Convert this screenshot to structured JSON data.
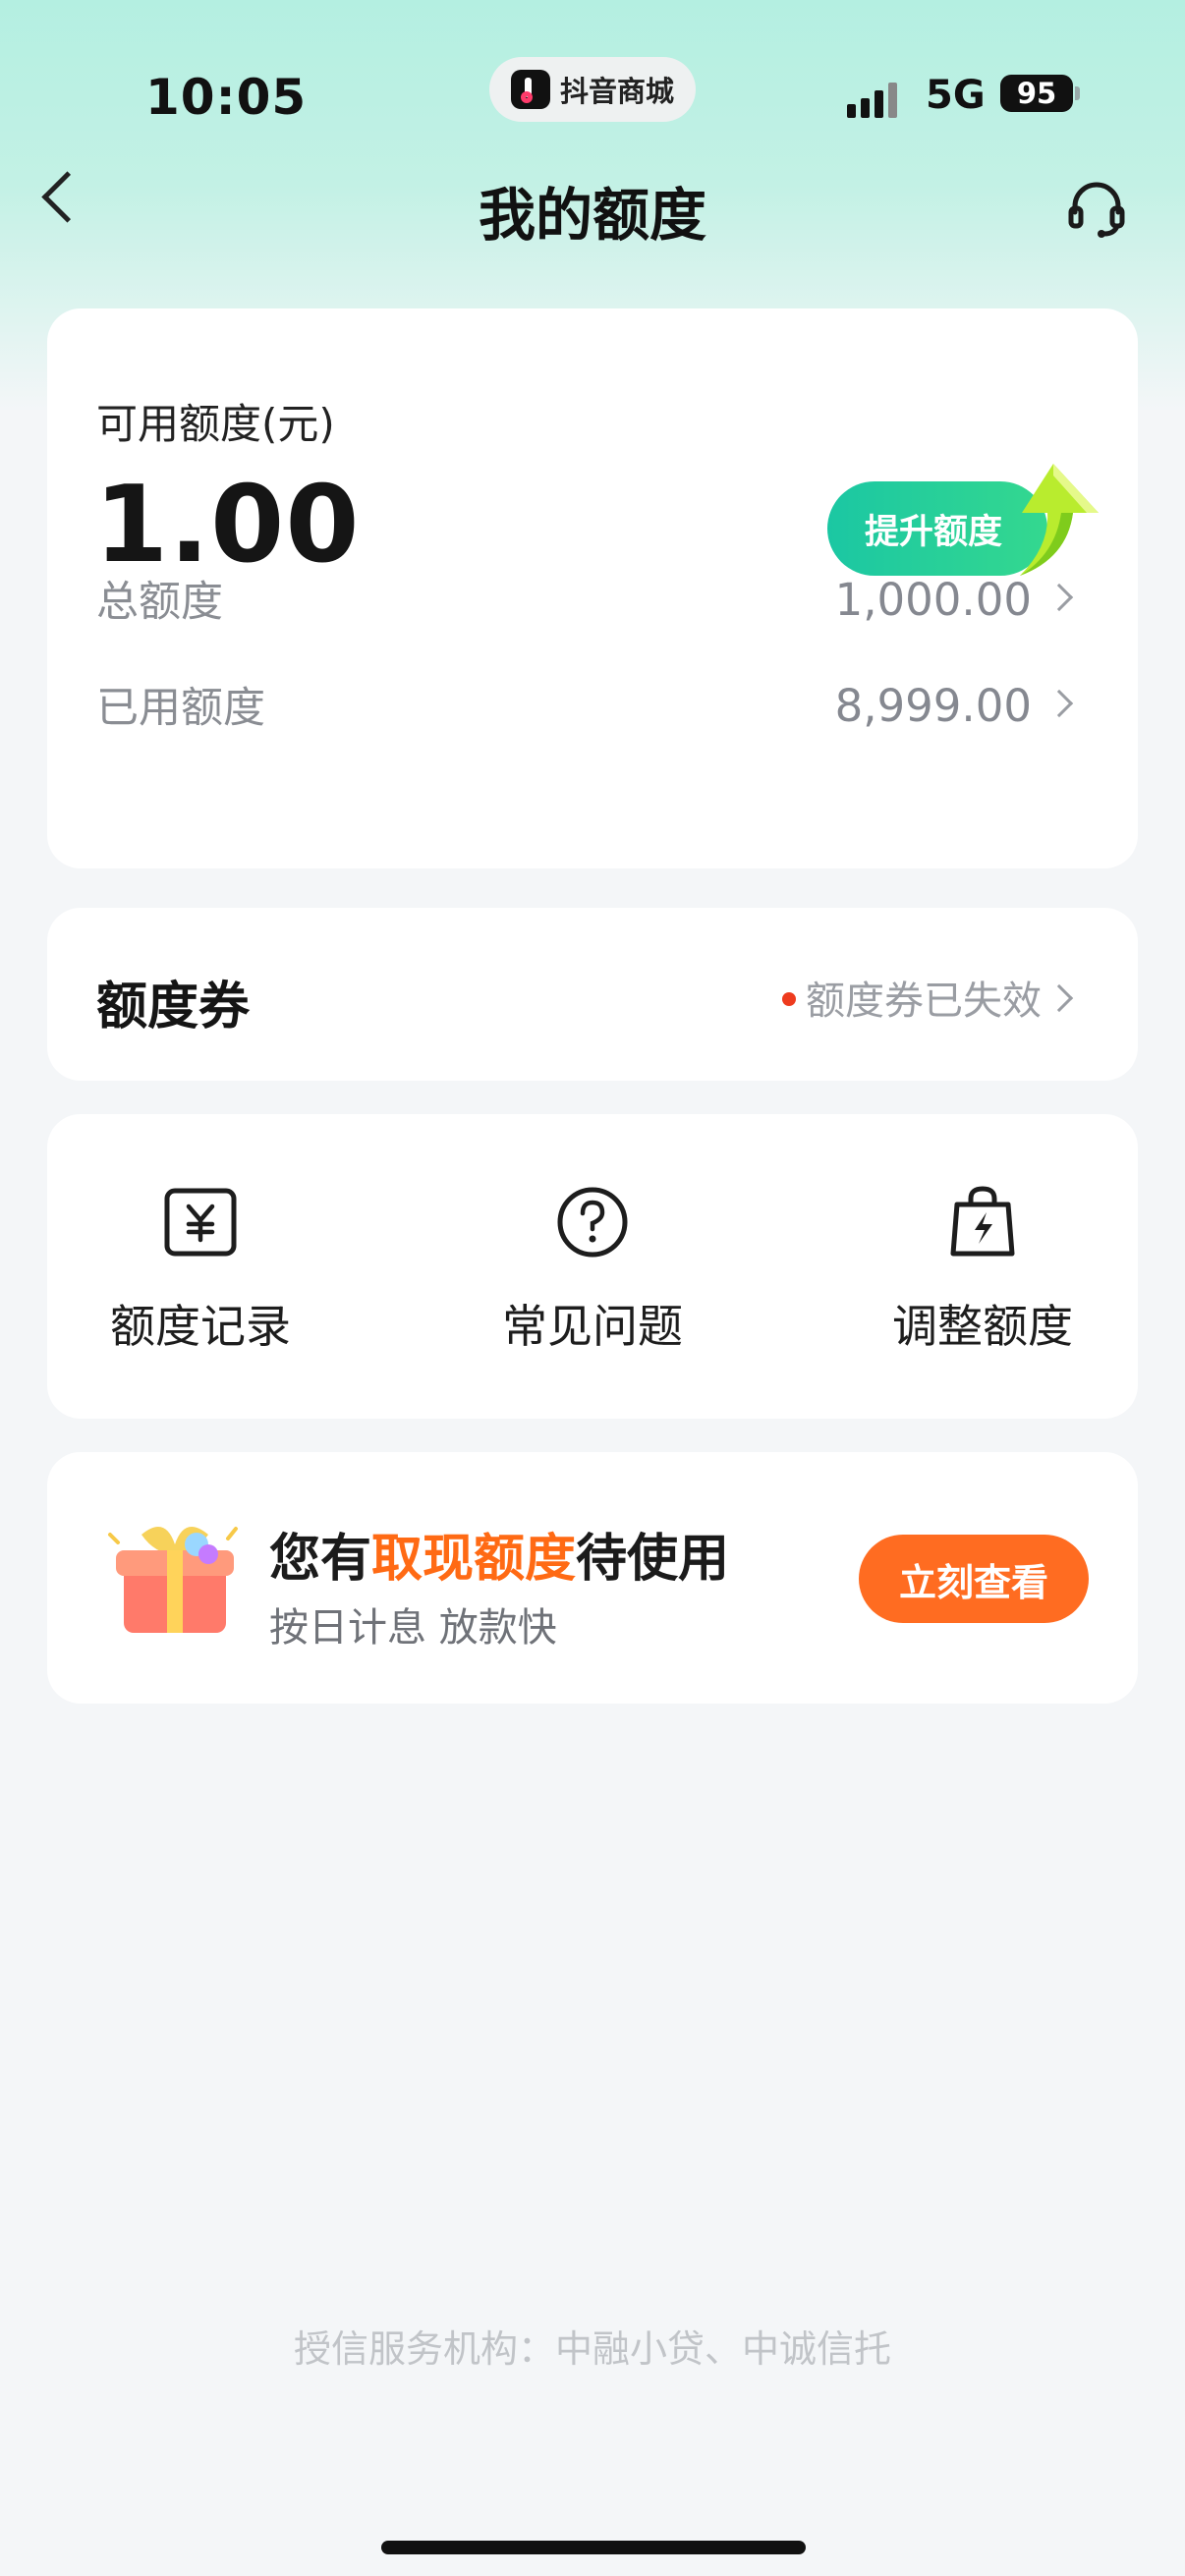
{
  "status_bar": {
    "time": "10:05",
    "app_name": "抖音商城",
    "network": "5G",
    "battery": "95"
  },
  "nav": {
    "title": "我的额度",
    "back_icon": "chevron-left-icon",
    "service_icon": "headset-icon"
  },
  "credit": {
    "available_label": "可用额度(元)",
    "available_amount": "1.00",
    "raise_button": "提升额度",
    "total_label": "总额度",
    "total_value": "1,000.00",
    "used_label": "已用额度",
    "used_value": "8,999.00"
  },
  "coupon": {
    "title": "额度券",
    "status": "额度券已失效",
    "status_dot_color": "#ee3b1e"
  },
  "menu": [
    {
      "label": "额度记录",
      "icon": "yen-receipt-icon"
    },
    {
      "label": "常见问题",
      "icon": "question-circle-icon"
    },
    {
      "label": "调整额度",
      "icon": "shopping-bag-bolt-icon"
    }
  ],
  "promo": {
    "title_prefix": "您有",
    "title_highlight": "取现额度",
    "title_suffix": "待使用",
    "subtitle": "按日计息 放款快",
    "button": "立刻查看",
    "highlight_color": "#ff6a14",
    "icon": "gift-box-icon"
  },
  "footer": {
    "text": "授信服务机构：中融小贷、中诚信托"
  },
  "colors": {
    "accent": "#1bc7a3",
    "orange": "#ff6c21",
    "background": "#f4f6f8"
  }
}
